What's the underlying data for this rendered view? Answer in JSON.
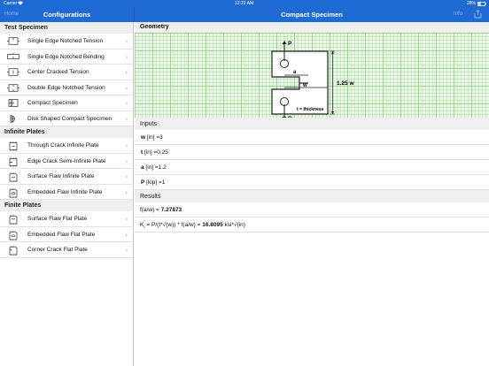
{
  "status_bar": {
    "carrier": "Carrier",
    "time": "12:22 AM",
    "battery": "28%"
  },
  "left_nav": {
    "back_label": "Home",
    "title": "Configurations"
  },
  "right_nav": {
    "title": "Compact Specimen",
    "action_label": "Info"
  },
  "sections": [
    {
      "title": "Test Specimen",
      "items": [
        {
          "label": "Single Edge Notched Tension",
          "icon": "sent-specimen-icon"
        },
        {
          "label": "Single Edge Notched Bending",
          "icon": "senb-specimen-icon"
        },
        {
          "label": "Center Cracked Tension",
          "icon": "cct-specimen-icon"
        },
        {
          "label": "Double Edge Notched Tension",
          "icon": "dent-specimen-icon"
        },
        {
          "label": "Compact Specimen",
          "icon": "compact-specimen-icon"
        },
        {
          "label": "Disk Shaped Compact Specimen",
          "icon": "disk-compact-specimen-icon"
        }
      ]
    },
    {
      "title": "Infinite Plates",
      "items": [
        {
          "label": "Through Crack Infinite Plate",
          "icon": "through-crack-plate-icon"
        },
        {
          "label": "Edge Crack Semi-Infinite Plate",
          "icon": "edge-crack-plate-icon"
        },
        {
          "label": "Surface Flaw Infinite Plate",
          "icon": "surface-flaw-plate-icon"
        },
        {
          "label": "Embedded Flaw Infinite Plate",
          "icon": "embedded-flaw-plate-icon"
        }
      ]
    },
    {
      "title": "Finite Plates",
      "items": [
        {
          "label": "Surface Flaw Flat Plate",
          "icon": "surface-flaw-flat-icon"
        },
        {
          "label": "Embedded Flaw Flat Plate",
          "icon": "embedded-flaw-flat-icon"
        },
        {
          "label": "Corner Crack Flat Plate",
          "icon": "corner-crack-flat-icon"
        }
      ]
    }
  ],
  "geometry": {
    "header": "Geometry",
    "load_top": "P",
    "load_bottom": "P",
    "crack_label": "a",
    "width_label": "w",
    "height_label": "1.25 w",
    "thickness_label": "t = thickness"
  },
  "inputs": {
    "header": "Inputs",
    "rows": [
      {
        "name": "w",
        "unit": " [in] =",
        "value": "3"
      },
      {
        "name": "t",
        "unit": " [in] =",
        "value": "0.25"
      },
      {
        "name": "a",
        "unit": " [in] =",
        "value": "1.2"
      },
      {
        "name": "P",
        "unit": " [kip] =",
        "value": "1"
      }
    ]
  },
  "results": {
    "header": "Results",
    "faw_label": "f(a/w) = ",
    "faw_value": "7.27873",
    "k_label": "K",
    "k_sub": "I",
    "k_formula": " = P/(t*√(w)) * f(a/w) = ",
    "k_value": "16.8095",
    "k_unit": "  ksi*√(in)"
  },
  "colors": {
    "nav_blue": "#1f6ad3",
    "grid_green": "#e9f6e5"
  }
}
